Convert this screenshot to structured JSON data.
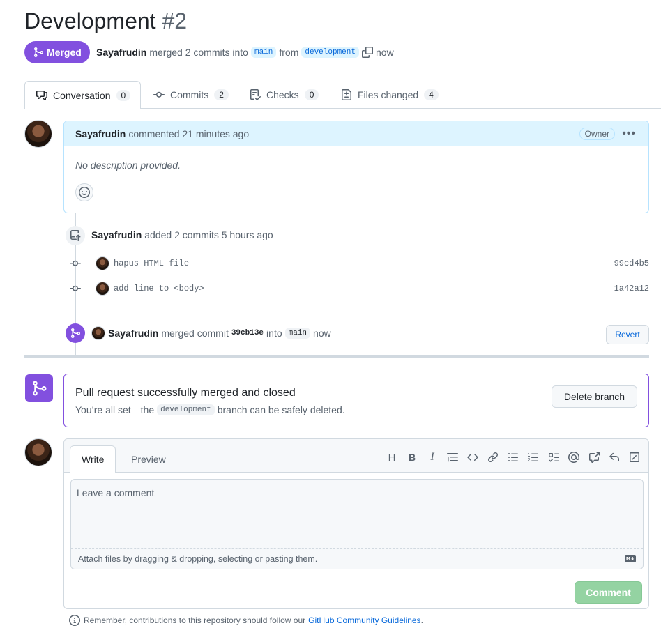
{
  "header": {
    "title": "Development",
    "number": "#2",
    "state": "Merged",
    "author": "Sayafrudin",
    "merge_text": "merged 2 commits into",
    "base_branch": "main",
    "from_text": "from",
    "head_branch": "development",
    "time": "now"
  },
  "tabs": [
    {
      "label": "Conversation",
      "count": "0",
      "icon": "comment-discussion-icon"
    },
    {
      "label": "Commits",
      "count": "2",
      "icon": "git-commit-icon"
    },
    {
      "label": "Checks",
      "count": "0",
      "icon": "checklist-icon"
    },
    {
      "label": "Files changed",
      "count": "4",
      "icon": "file-diff-icon"
    }
  ],
  "comment": {
    "author": "Sayafrudin",
    "action": "commented 21 minutes ago",
    "badge": "Owner",
    "body": "No description provided."
  },
  "timeline": {
    "push_author": "Sayafrudin",
    "push_text": "added 2 commits 5 hours ago",
    "commits": [
      {
        "message": "hapus HTML file",
        "sha": "99cd4b5"
      },
      {
        "message": "add line to <body>",
        "sha": "1a42a12"
      }
    ],
    "merge_author": "Sayafrudin",
    "merge_text": "merged commit",
    "merge_sha": "39cb13e",
    "merge_into": "into",
    "merge_branch": "main",
    "merge_time": "now",
    "revert_label": "Revert"
  },
  "merged_box": {
    "title": "Pull request successfully merged and closed",
    "sub_before": "You’re all set—the",
    "branch": "development",
    "sub_after": "branch can be safely deleted.",
    "delete_label": "Delete branch"
  },
  "editor": {
    "tab_write": "Write",
    "tab_preview": "Preview",
    "placeholder": "Leave a comment",
    "attach_text": "Attach files by dragging & dropping, selecting or pasting them.",
    "submit_label": "Comment"
  },
  "footer": {
    "text": "Remember, contributions to this repository should follow our",
    "link": "GitHub Community Guidelines",
    "end": "."
  },
  "colors": {
    "merged_purple": "#8250df",
    "link_blue": "#0969da",
    "comment_header_bg": "#ddf4ff",
    "comment_button_disabled": "#94d3a2"
  }
}
